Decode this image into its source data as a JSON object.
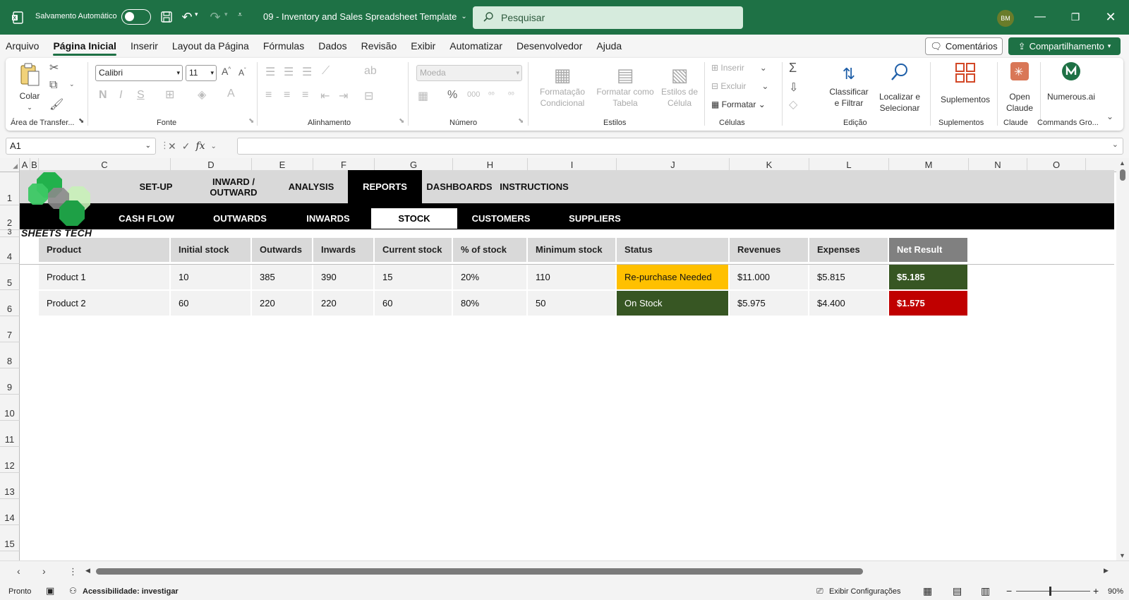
{
  "titlebar": {
    "autosave_label": "Salvamento Automático",
    "doc_title": "09 - Inventory and Sales Spreadsheet Template",
    "search_placeholder": "Pesquisar",
    "avatar_initials": "BM"
  },
  "menu": {
    "items": [
      "Arquivo",
      "Página Inicial",
      "Inserir",
      "Layout da Página",
      "Fórmulas",
      "Dados",
      "Revisão",
      "Exibir",
      "Automatizar",
      "Desenvolvedor",
      "Ajuda"
    ],
    "active": "Página Inicial",
    "comments_label": "Comentários",
    "share_label": "Compartilhamento"
  },
  "ribbon": {
    "paste_label": "Colar",
    "font_name": "Calibri",
    "font_size": "11",
    "number_format": "Moeda",
    "cond_format_label": "Formatação Condicional",
    "format_table_label": "Formatar como Tabela",
    "cell_styles_label": "Estilos de Célula",
    "insert_label": "Inserir",
    "delete_label": "Excluir",
    "format_label": "Formatar",
    "sort_label": "Classificar e Filtrar",
    "find_label": "Localizar e Selecionar",
    "addins_label": "Suplementos",
    "claude_label": "Open Claude",
    "numerous_label": "Numerous.ai",
    "groups": {
      "clipboard": "Área de Transfer...",
      "font": "Fonte",
      "alignment": "Alinhamento",
      "number": "Número",
      "styles": "Estilos",
      "cells": "Células",
      "editing": "Edição",
      "addins": "Suplementos",
      "claude": "Claude",
      "commands": "Commands Gro..."
    }
  },
  "formula_bar": {
    "name_box": "A1",
    "fx": "fx",
    "formula": ""
  },
  "columns": [
    "A",
    "B",
    "C",
    "D",
    "E",
    "F",
    "G",
    "H",
    "I",
    "J",
    "K",
    "L",
    "M",
    "N",
    "O"
  ],
  "rows": [
    "1",
    "2",
    "3",
    "4",
    "5",
    "6",
    "7",
    "8",
    "9",
    "10",
    "11",
    "12",
    "13",
    "14",
    "15"
  ],
  "nav": {
    "tabs": [
      "SET-UP",
      "INWARD /\nOUTWARD",
      "ANALYSIS",
      "REPORTS",
      "DASHBOARDS",
      "INSTRUCTIONS"
    ],
    "active": "REPORTS",
    "subtabs": [
      "CASH FLOW",
      "OUTWARDS",
      "INWARDS",
      "STOCK",
      "CUSTOMERS",
      "SUPPLIERS"
    ],
    "active_subtab": "STOCK",
    "logo_text": "SHEETS TECH"
  },
  "table": {
    "headers": [
      "Product",
      "Initial stock",
      "Outwards",
      "Inwards",
      "Current stock",
      "% of stock",
      "Minimum stock",
      "Status",
      "Revenues",
      "Expenses",
      "Net Result"
    ],
    "rows": [
      [
        "Product 1",
        "10",
        "385",
        "390",
        "15",
        "20%",
        "110",
        "Re-purchase Needed",
        "$11.000",
        "$5.815",
        "$5.185"
      ],
      [
        "Product 2",
        "60",
        "220",
        "220",
        "60",
        "80%",
        "50",
        "On Stock",
        "$5.975",
        "$4.400",
        "$1.575"
      ]
    ],
    "status_colors": {
      "Re-purchase Needed": "#ffc000",
      "On Stock": "#375623"
    },
    "net_colors": [
      "#375623",
      "#c00000"
    ]
  },
  "status": {
    "ready": "Pronto",
    "accessibility": "Acessibilidade: investigar",
    "display_settings": "Exibir Configurações",
    "zoom": "90%"
  },
  "colors": {
    "brand": "#1e7145"
  }
}
